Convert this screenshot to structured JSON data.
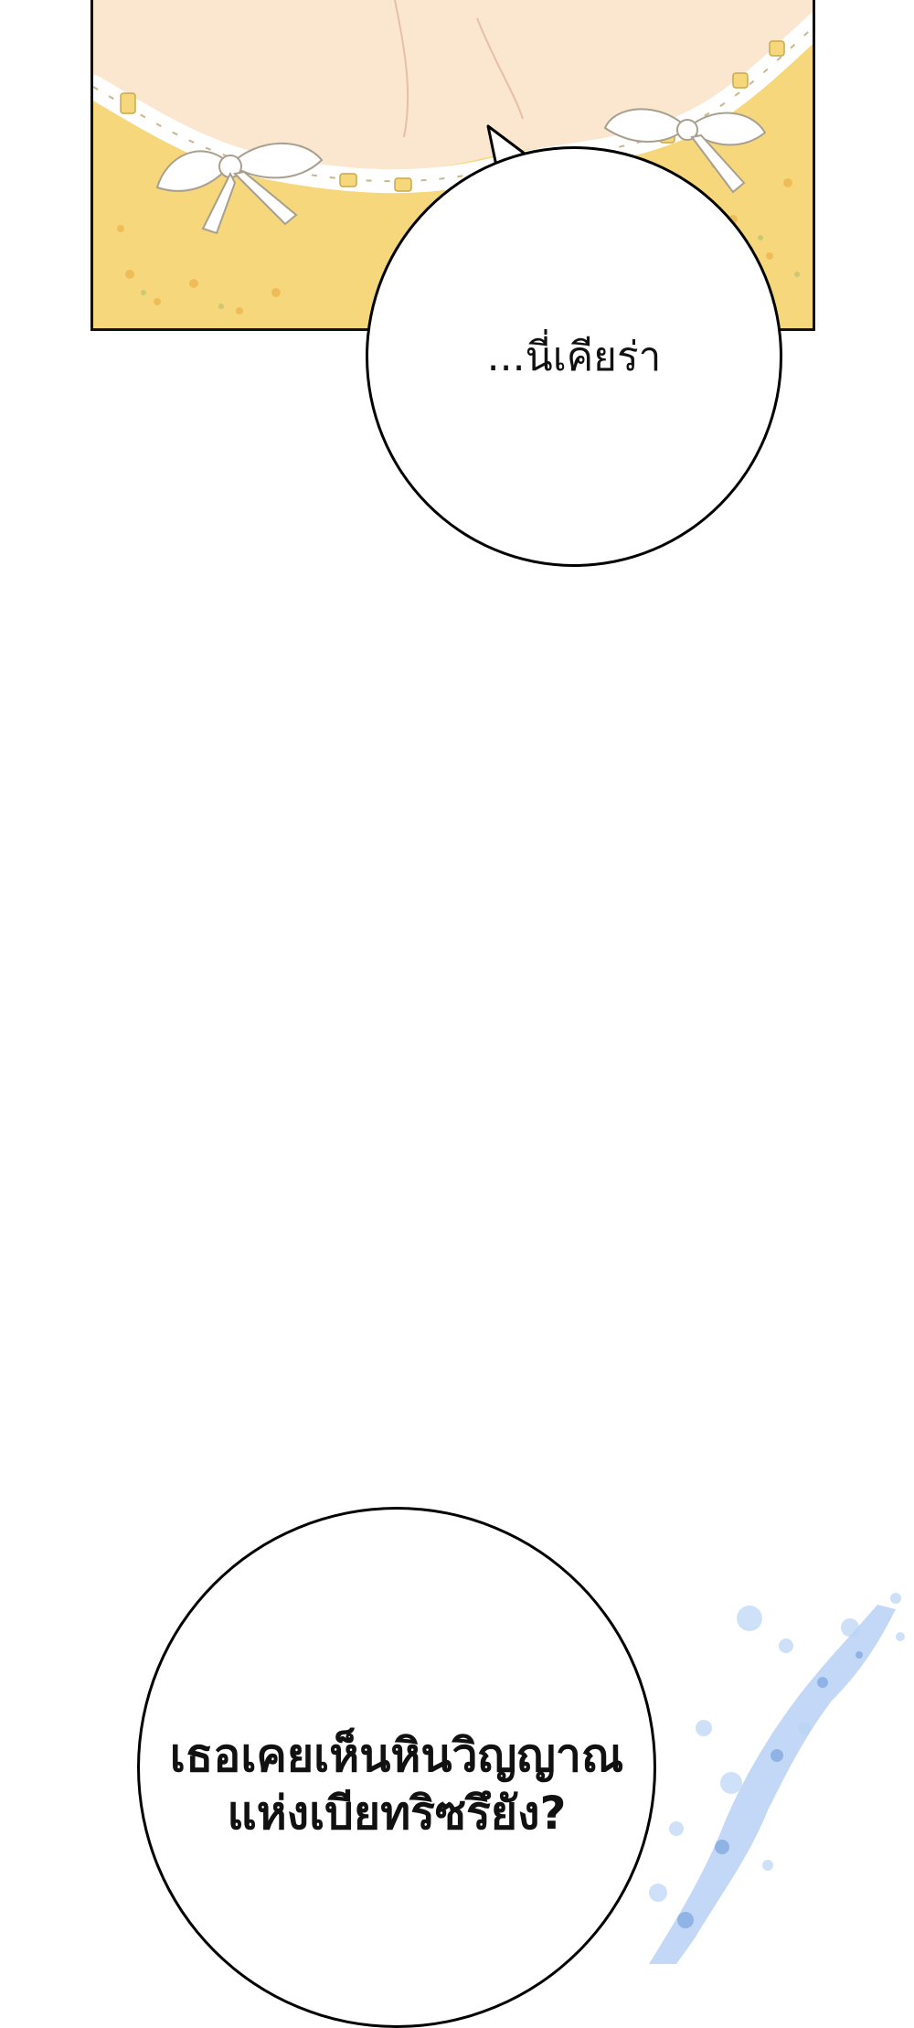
{
  "panel": {
    "kind": "comic-illustration"
  },
  "bubbles": {
    "first": {
      "text": "...นี่เคียร่า"
    },
    "second": {
      "line1": "เธอเคยเห็นหินวิญญาณ",
      "line2": "แห่งเบียทริซรึยัง?"
    }
  },
  "colors": {
    "dress": "#f6d77c",
    "skin": "#fbe6cf",
    "lace": "#ffffff",
    "crystal": "#8fb8ee"
  }
}
